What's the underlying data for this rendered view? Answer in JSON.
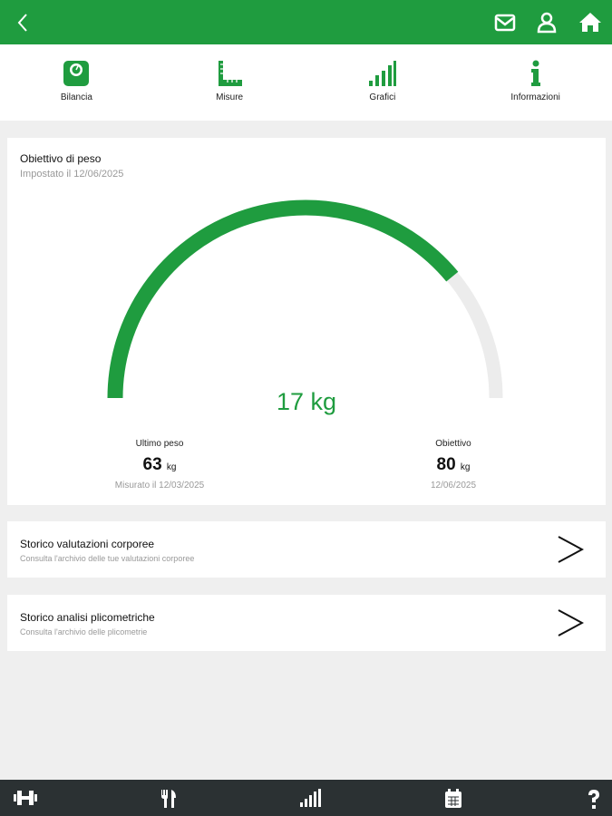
{
  "header": {
    "back": "back-icon",
    "icons": [
      "mail-icon",
      "user-icon",
      "home-icon"
    ]
  },
  "nav": [
    {
      "label": "Bilancia"
    },
    {
      "label": "Misure"
    },
    {
      "label": "Grafici"
    },
    {
      "label": "Informazioni"
    }
  ],
  "goal": {
    "title": "Obiettivo di peso",
    "subtitle": "Impostato il 12/06/2025",
    "center_value": "17 kg",
    "progress_fraction": 0.78,
    "last": {
      "label": "Ultimo peso",
      "value": "63",
      "unit": "kg",
      "note": "Misurato il 12/03/2025"
    },
    "target": {
      "label": "Obiettivo",
      "value": "80",
      "unit": "kg",
      "note": "12/06/2025"
    }
  },
  "rows": [
    {
      "title": "Storico valutazioni corporee",
      "subtitle": "Consulta l'archivio delle tue valutazioni corporee"
    },
    {
      "title": "Storico analisi plicometriche",
      "subtitle": "Consulta l'archivio delle plicometrie"
    }
  ],
  "colors": {
    "accent": "#1f9c3f",
    "track": "#ececec",
    "bottom": "#2b3133"
  }
}
